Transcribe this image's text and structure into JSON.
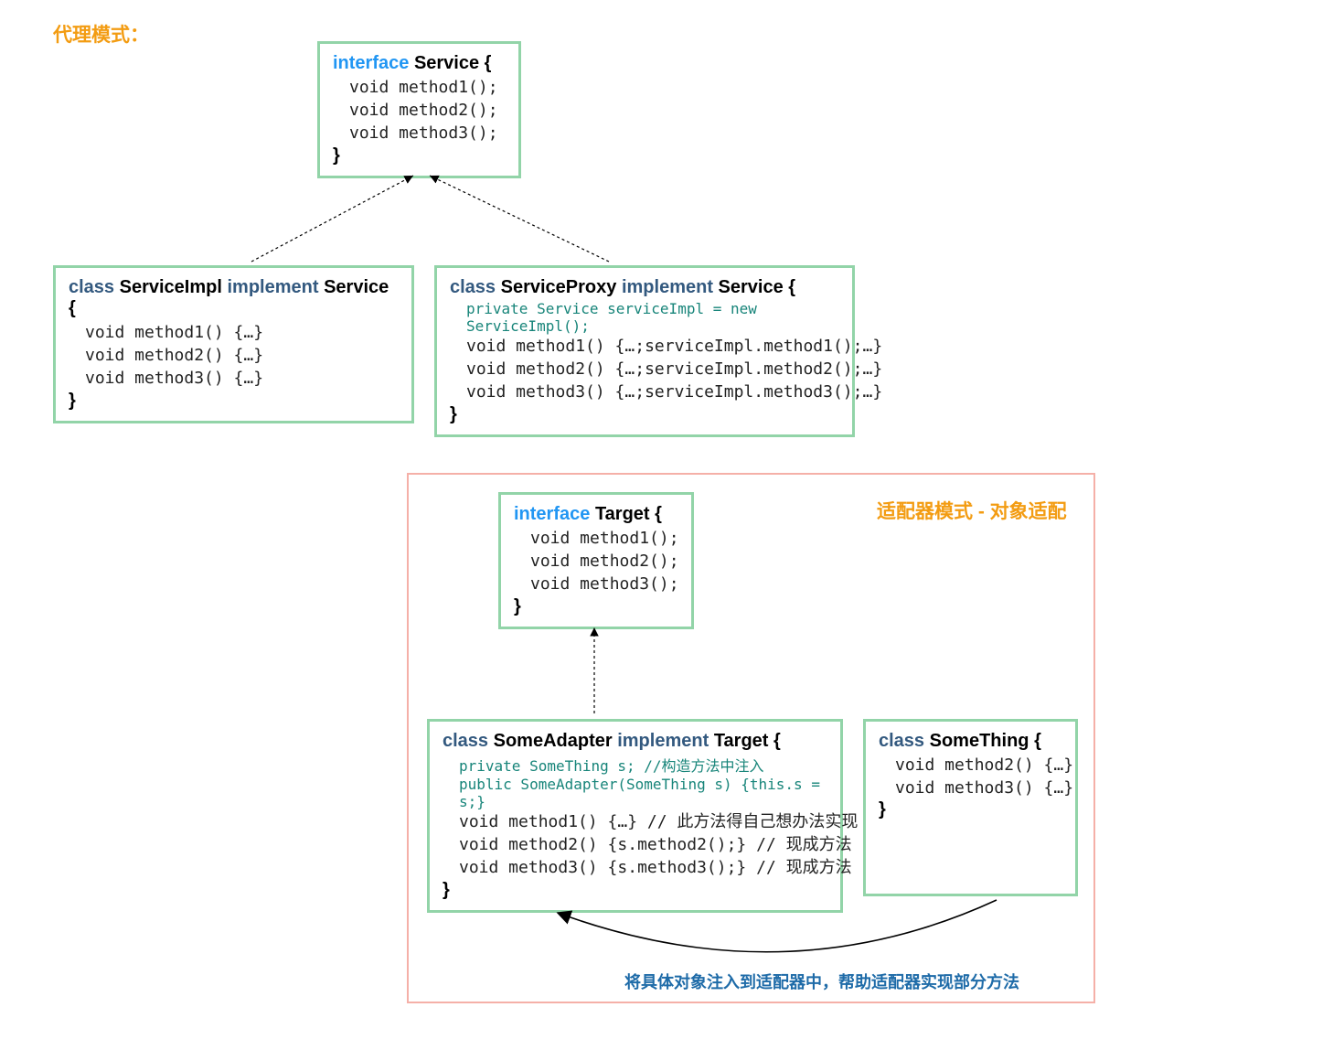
{
  "titles": {
    "proxy": "代理模式：",
    "adapter": "适配器模式 - 对象适配"
  },
  "boxes": {
    "service": {
      "kw": "interface",
      "name": "Service",
      "open": "{",
      "lines": [
        "void method1();",
        "void method2();",
        "void method3();"
      ],
      "close": "}"
    },
    "serviceImpl": {
      "kw": "class",
      "name": "ServiceImpl",
      "impl_kw": "implement",
      "impl_name": "Service",
      "open": "{",
      "lines": [
        "void method1() {…}",
        "void method2() {…}",
        "void method3() {…}"
      ],
      "close": "}"
    },
    "serviceProxy": {
      "kw": "class",
      "name": "ServiceProxy",
      "impl_kw": "implement",
      "impl_name": "Service",
      "open": "{",
      "priv": "private Service serviceImpl = new ServiceImpl();",
      "lines": [
        "void method1() {…;serviceImpl.method1();…}",
        "void method2() {…;serviceImpl.method2();…}",
        "void method3() {…;serviceImpl.method3();…}"
      ],
      "close": "}"
    },
    "target": {
      "kw": "interface",
      "name": "Target",
      "open": "{",
      "lines": [
        "void method1();",
        "void method2();",
        "void method3();"
      ],
      "close": "}"
    },
    "someAdapter": {
      "kw": "class",
      "name": "SomeAdapter",
      "impl_kw": "implement",
      "impl_name": "Target",
      "open": "{",
      "priv": "private SomeThing s; //构造方法中注入",
      "ctor": "public SomeAdapter(SomeThing s) {this.s = s;}",
      "lines": [
        "void method1() {…} // 此方法得自己想办法实现",
        "void method2() {s.method2();} // 现成方法",
        "void method3() {s.method3();} // 现成方法"
      ],
      "close": "}"
    },
    "someThing": {
      "kw": "class",
      "name": "SomeThing",
      "open": "{",
      "lines": [
        "void method2() {…}",
        "void method3() {…}"
      ],
      "close": "}"
    }
  },
  "footer": "将具体对象注入到适配器中，帮助适配器实现部分方法"
}
